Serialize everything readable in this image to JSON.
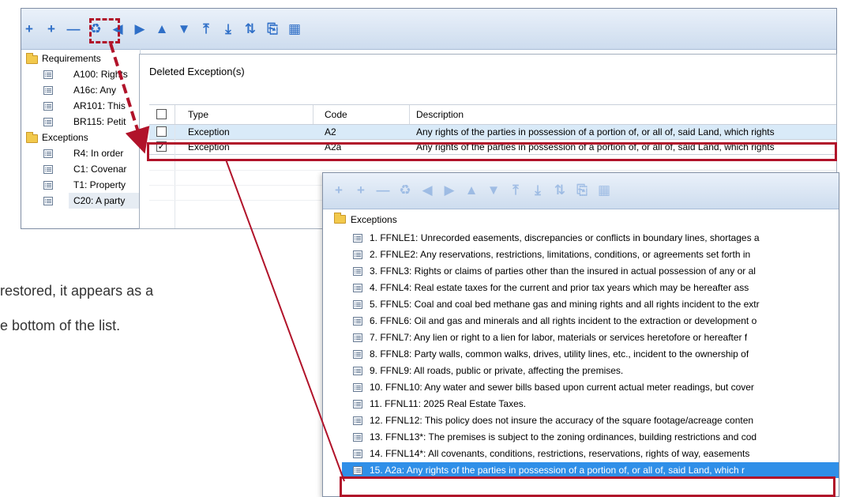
{
  "toolbar": {
    "icons": [
      "add-icon",
      "add-child-icon",
      "remove-icon",
      "restore-icon",
      "nav-left-icon",
      "nav-right-icon",
      "move-up-icon",
      "move-down-icon",
      "move-top-icon",
      "move-bottom-icon",
      "split-icon",
      "copy-icon",
      "view-icon"
    ],
    "glyphs": [
      "+",
      "+",
      "—",
      "♻",
      "◀",
      "▶",
      "▲",
      "▼",
      "⤒",
      "⤓",
      "⇅",
      "⎘",
      "▦"
    ]
  },
  "tree": {
    "groups": [
      {
        "label": "Requirements",
        "items": [
          "A100: Rights",
          "A16c: Any",
          "AR101: This",
          "BR115: Petit"
        ]
      },
      {
        "label": "Exceptions",
        "items": [
          "R4: In order",
          "C1: Covenar",
          "T1: Property",
          "C20: A party"
        ]
      }
    ]
  },
  "dialog": {
    "title": "Deleted Exception(s)",
    "columns": [
      "Type",
      "Code",
      "Description"
    ],
    "rows": [
      {
        "checked": false,
        "type": "Exception",
        "code": "A2",
        "description": "Any rights of the parties in possession of a portion of, or all of, said Land, which rights"
      },
      {
        "checked": true,
        "type": "Exception",
        "code": "A2a",
        "description": "Any rights of the parties in possession of a portion of, or all of, said Land, which rights"
      }
    ],
    "check_mark": "✓"
  },
  "caption": {
    "line1": "restored, it appears as a",
    "line2": "e bottom of the list."
  },
  "list_panel": {
    "folder_label": "Exceptions",
    "items": [
      "1. FFNLE1: Unrecorded easements, discrepancies or conflicts in boundary lines, shortages a",
      "2. FFNLE2: Any reservations, restrictions, limitations, conditions, or agreements set forth in",
      "3. FFNL3: Rights or claims of parties other than the insured in actual possession of any or al",
      "4. FFNL4: Real estate taxes for the current and prior tax years which may be hereafter ass",
      "5. FFNL5: Coal and coal bed methane gas and mining rights and all rights incident to the extr",
      "6. FFNL6: Oil and gas and minerals and all rights incident to the extraction or development o",
      "7. FFNL7: Any lien or right to a lien for labor, materials or services heretofore or hereafter f",
      "8. FFNL8: Party walls, common walks, drives, utility lines, etc., incident to the ownership of",
      "9. FFNL9: All roads, public or private, affecting the premises.",
      "10. FFNL10: Any water and sewer bills based upon current actual meter readings, but cover",
      "11. FFNL11: 2025 Real Estate Taxes.",
      "12. FFNL12: This policy does not insure the accuracy of the square footage/acreage conten",
      "13. FFNL13*: The premises is subject to the zoning ordinances, building restrictions and cod",
      "14. FFNL14*: All covenants, conditions, restrictions, reservations, rights of way, easements",
      "15. A2a: Any rights of the parties in possession of a portion of, or all of, said Land, which r"
    ]
  },
  "colors": {
    "highlight": "#b1132a",
    "selection": "#2f8fe8",
    "row_hover": "#d9eaf8"
  }
}
